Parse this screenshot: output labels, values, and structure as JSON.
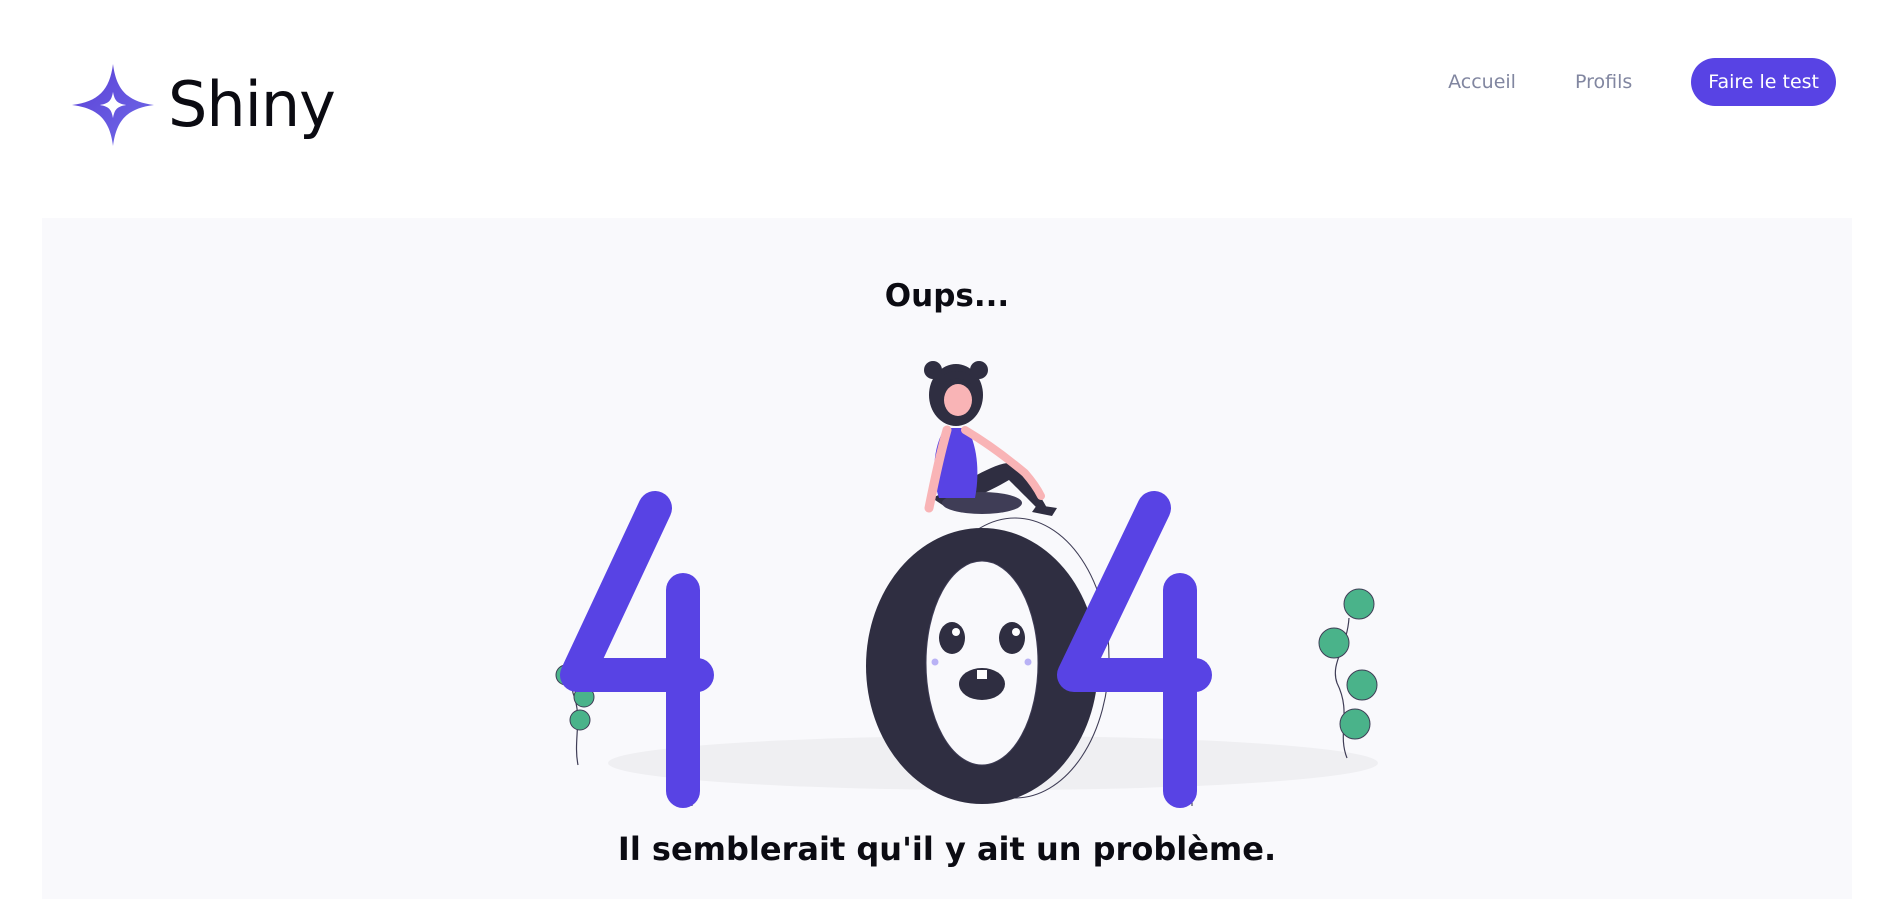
{
  "brand": {
    "name": "Shiny",
    "logo_icon": "four-point-star-icon"
  },
  "nav": {
    "links": [
      {
        "label": "Accueil"
      },
      {
        "label": "Profils"
      }
    ],
    "cta_label": "Faire le test"
  },
  "error_page": {
    "title": "Oups...",
    "illustration": "404-illustration",
    "message": "Il semblerait qu'il y ait un problème."
  },
  "colors": {
    "accent": "#5843e4",
    "dark": "#2f2e41",
    "plant": "#4ab38a",
    "background_panel": "#f9f9fc"
  }
}
